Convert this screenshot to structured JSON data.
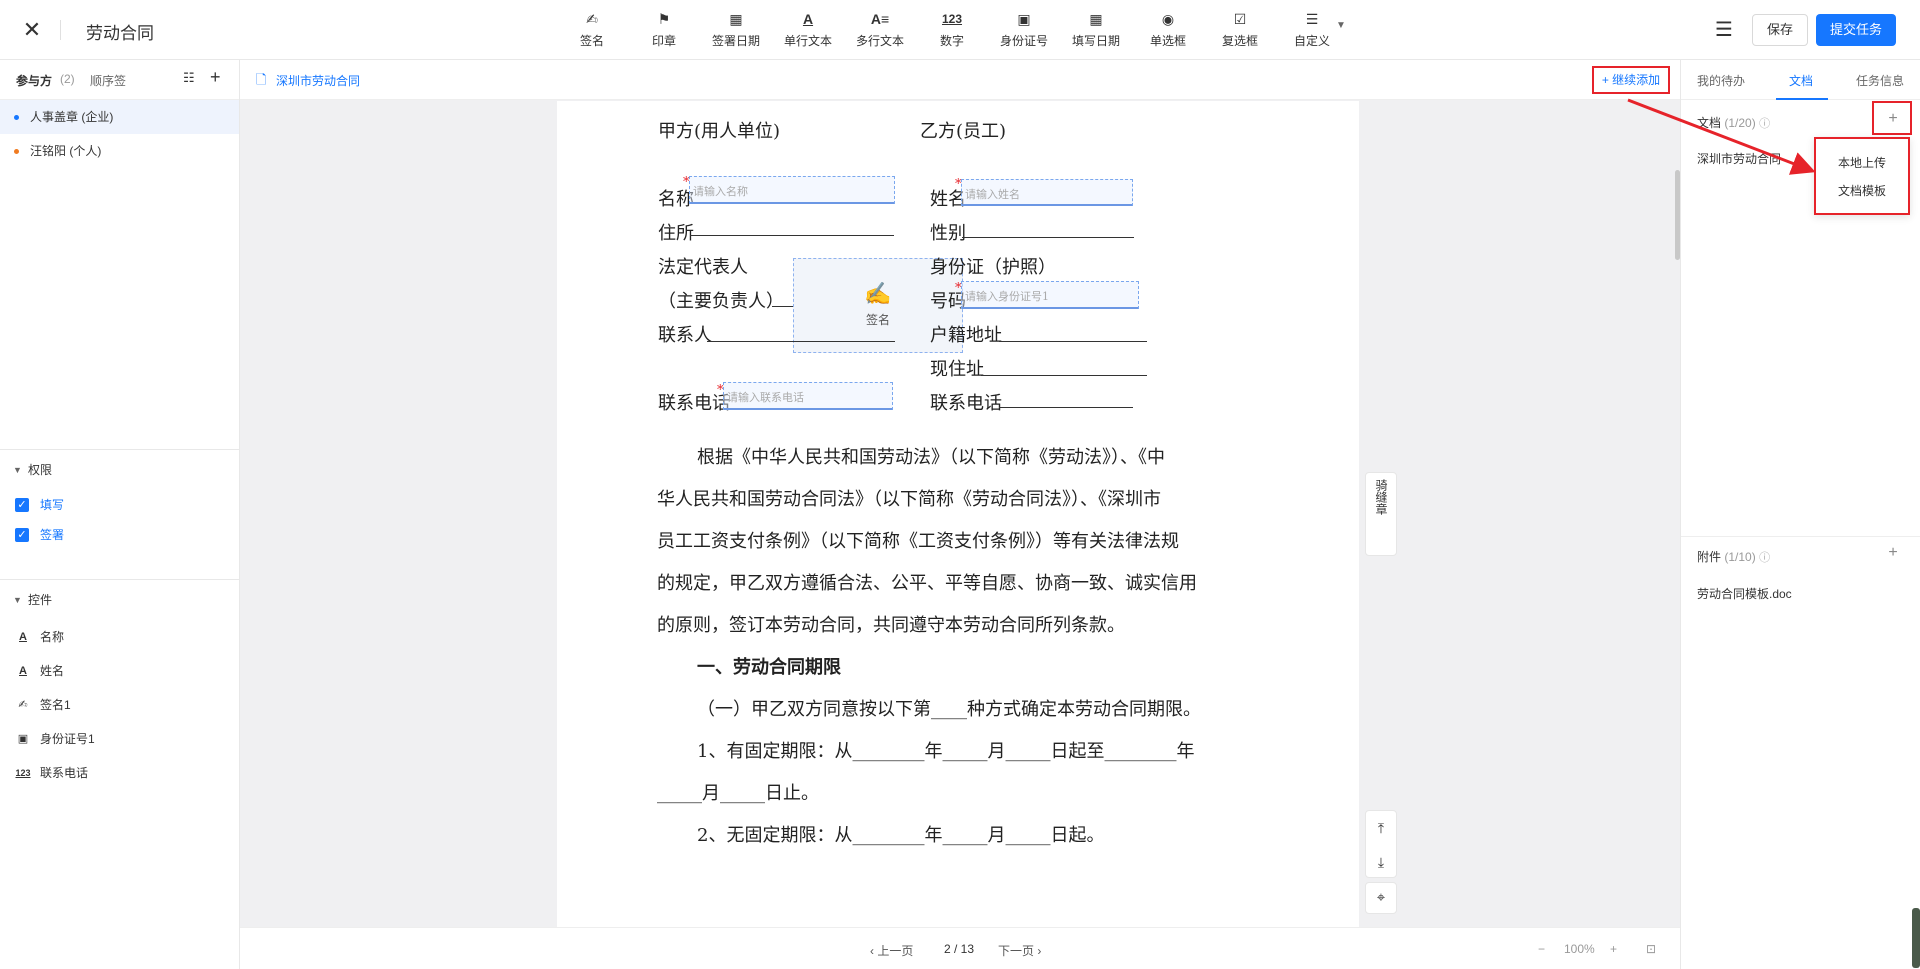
{
  "header": {
    "close_icon": "close-icon",
    "title": "劳动合同",
    "tools": [
      {
        "icon": "✍",
        "label": "签名"
      },
      {
        "icon": "⚑",
        "label": "印章"
      },
      {
        "icon": "▦",
        "label": "签署日期"
      },
      {
        "icon": "A",
        "label": "单行文本"
      },
      {
        "icon": "A≡",
        "label": "多行文本"
      },
      {
        "icon": "123",
        "label": "数字"
      },
      {
        "icon": "▣",
        "label": "身份证号"
      },
      {
        "icon": "▦",
        "label": "填写日期"
      },
      {
        "icon": "◉",
        "label": "单选框"
      },
      {
        "icon": "☑",
        "label": "复选框"
      },
      {
        "icon": "☰",
        "label": "自定义"
      }
    ],
    "menu_icon": "☰",
    "save_label": "保存",
    "submit_label": "提交任务"
  },
  "left_panel": {
    "tab_participants": "参与方",
    "participants_count": "(2)",
    "tab_order": "顺序签",
    "parties": [
      {
        "name": "人事盖章 (企业)",
        "dot_color": "#1677ff"
      },
      {
        "name": "汪铭阳 (个人)",
        "dot_color": "#f07b20"
      }
    ],
    "permissions_title": "权限",
    "permissions": [
      {
        "label": "填写",
        "checked": true
      },
      {
        "label": "签署",
        "checked": true
      }
    ],
    "controls_title": "控件",
    "controls": [
      {
        "icon": "A",
        "label": "名称"
      },
      {
        "icon": "A",
        "label": "姓名"
      },
      {
        "icon": "✍",
        "label": "签名1"
      },
      {
        "icon": "▣",
        "label": "身份证号1"
      },
      {
        "icon": "123",
        "label": "联系电话"
      }
    ]
  },
  "doc_bar": {
    "doc_name": "深圳市劳动合同",
    "continue_add": "+ 继续添加"
  },
  "document": {
    "party_a": "甲方(用人单位)",
    "party_b": "乙方(员工)",
    "name_label": "名称",
    "name_placeholder": "请输入名称",
    "address_label": "住所",
    "legal_rep_label": "法定代表人",
    "principal_label": "（主要负责人）",
    "contact_label": "联系人",
    "phone_label": "联系电话",
    "phone_placeholder": "请输入联系电话",
    "full_name_label": "姓名",
    "full_name_placeholder": "请输入姓名",
    "gender_label": "性别",
    "id_label": "身份证（护照）",
    "id_number_label": "号码",
    "id_placeholder": "请输入身份证号1",
    "household_label": "户籍地址",
    "current_address_label": "现住址",
    "b_phone_label": "联系电话",
    "signature_label": "签名",
    "paragraph_lines": [
      "根据《中华人民共和国劳动法》（以下简称《劳动法》）、《中",
      "华人民共和国劳动合同法》（以下简称《劳动合同法》）、《深圳市",
      "员工工资支付条例》（以下简称《工资支付条例》）等有关法律法规",
      "的规定，甲乙双方遵循合法、公平、平等自愿、协商一致、诚实信用",
      "的原则，签订本劳动合同，共同遵守本劳动合同所列条款。"
    ],
    "section_title": "一、劳动合同期限",
    "clause1": "（一）甲乙双方同意按以下第____种方式确定本劳动合同期限。",
    "clause_fixed": "1、有固定期限：从________年_____月_____日起至________年",
    "clause_fixed2": "_____月_____日止。",
    "clause_unfixed": "2、无固定期限：从________年_____月_____日起。"
  },
  "side_tools": {
    "seam_stamp": "骑缝章",
    "top_icon": "⤒",
    "bottom_icon": "⤓",
    "locate_icon": "⌖"
  },
  "pager": {
    "prev": "‹ 上一页",
    "page": "2 / 13",
    "next": "下一页 ›",
    "zoom_out": "−",
    "zoom": "100%",
    "zoom_in": "+"
  },
  "right_panel": {
    "tabs": [
      "我的待办",
      "文档",
      "任务信息"
    ],
    "active_tab": "文档",
    "docs_title": "文档",
    "docs_count": "(1/20)",
    "doc_item": "深圳市劳动合同",
    "dropdown": [
      "本地上传",
      "文档模板"
    ],
    "attachments_title": "附件",
    "attachments_count": "(1/10)",
    "attachment_item": "劳动合同模板.doc"
  },
  "colors": {
    "accent": "#1677ff",
    "highlight_red": "#e6232a"
  }
}
